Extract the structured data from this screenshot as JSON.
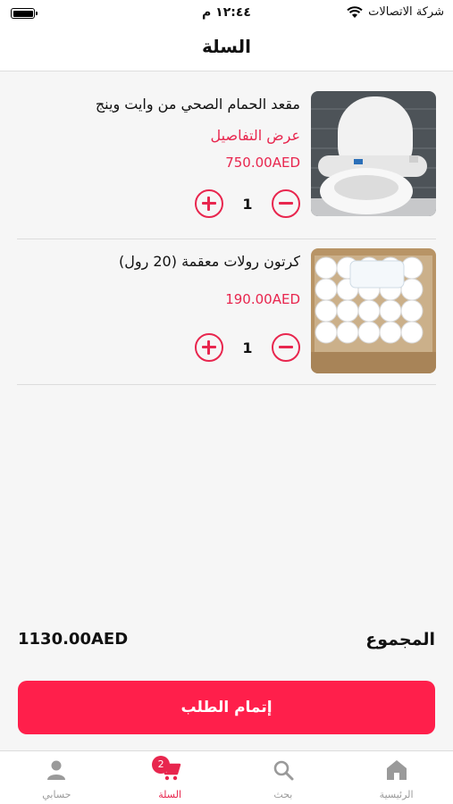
{
  "status_bar": {
    "time": "١٢:٤٤ م",
    "carrier": "شركة الاتصالات"
  },
  "header": {
    "title": "السلة"
  },
  "cart": {
    "items": [
      {
        "name": "مقعد الحمام الصحي من وايت وينج",
        "details_link": "عرض التفاصيل",
        "price": "750.00AED",
        "quantity": "1",
        "image_icon": "toilet-seat-image"
      },
      {
        "name": "كرتون رولات معقمة (20 رول)",
        "price": "190.00AED",
        "quantity": "1",
        "image_icon": "tissue-rolls-image"
      }
    ]
  },
  "summary": {
    "total_label": "المجموع",
    "total_amount": "1130.00AED"
  },
  "checkout": {
    "label": "إتمام الطلب"
  },
  "tab_bar": {
    "tabs": [
      {
        "label": "الرئيسية",
        "icon": "home-icon"
      },
      {
        "label": "بحث",
        "icon": "search-icon"
      },
      {
        "label": "السلة",
        "icon": "cart-icon",
        "badge": "2",
        "active": true
      },
      {
        "label": "حسابي",
        "icon": "user-icon"
      }
    ]
  },
  "colors": {
    "accent": "#e8264e",
    "checkout_button": "#ff1f4b",
    "inactive_tab": "#9a9a9a"
  }
}
